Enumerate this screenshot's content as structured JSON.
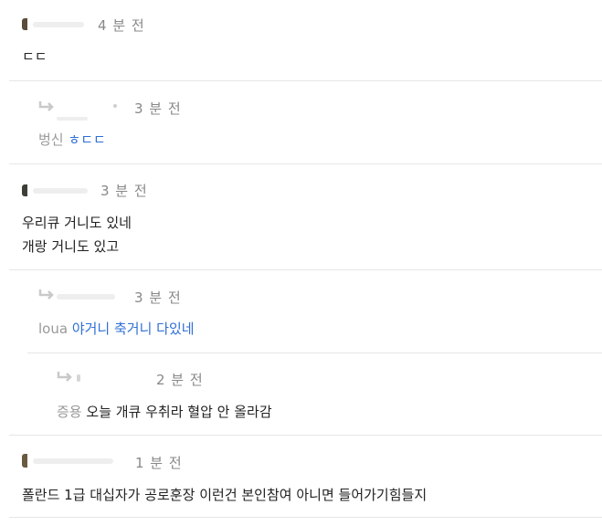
{
  "comments": [
    {
      "time": "4 분 전",
      "text": "ㄷㄷ"
    },
    {
      "time": "3 분 전",
      "mention": "벙신",
      "text": "ㅎㄷㄷ"
    },
    {
      "time": "3 분 전",
      "lines": [
        "우리큐 거니도 있네",
        "개랑 거니도 있고"
      ]
    },
    {
      "time": "3 분 전",
      "mention": "loua",
      "text": "야거니 축거니 다있네"
    },
    {
      "time": "2 분 전",
      "mention": "증용",
      "text": "오늘 개큐 우취라 혈압 안 올라감"
    },
    {
      "time": "1 분 전",
      "text": "폴란드 1급 대십자가 공로훈장 이런건 본인참여 아니면 들어가기힘들지"
    }
  ],
  "colors": {
    "time": "#888888",
    "mention": "#999999",
    "reply_text": "#2f6fd6",
    "divider": "#e6e6e6"
  },
  "icons": {
    "reply": "reply-arrow-icon",
    "avatar": "avatar"
  }
}
